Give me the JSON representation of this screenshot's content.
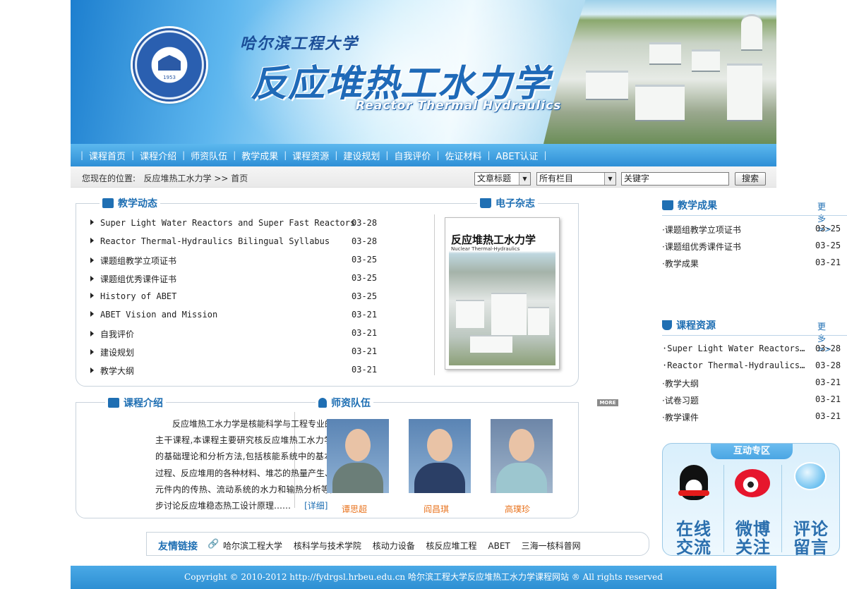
{
  "banner": {
    "university_calligraphy": "哈尔滨工程大学",
    "title": "反应堆热工水力学",
    "subtitle": "Reactor Thermal Hydraulics",
    "seal_year": "1953"
  },
  "nav": {
    "items": [
      "课程首页",
      "课程介绍",
      "师资队伍",
      "教学成果",
      "课程资源",
      "建设规划",
      "自我评价",
      "佐证材料",
      "ABET认证"
    ]
  },
  "location": {
    "label": "您现在的位置:",
    "path": "反应堆热工水力学 >> 首页"
  },
  "search": {
    "type_select": "文章标题",
    "column_select": "所有栏目",
    "keyword_placeholder": "关键字",
    "button": "搜索"
  },
  "news": {
    "title": "教学动态",
    "items": [
      {
        "text": "Super Light Water Reactors and Super Fast Reactors",
        "date": "03-28"
      },
      {
        "text": "Reactor Thermal-Hydraulics Bilingual Syllabus",
        "date": "03-28"
      },
      {
        "text": "课题组教学立项证书",
        "date": "03-25"
      },
      {
        "text": "课题组优秀课件证书",
        "date": "03-25"
      },
      {
        "text": "History of ABET",
        "date": "03-25"
      },
      {
        "text": "ABET Vision and Mission",
        "date": "03-21"
      },
      {
        "text": "自我评价",
        "date": "03-21"
      },
      {
        "text": "建设规划",
        "date": "03-21"
      },
      {
        "text": "教学大纲",
        "date": "03-21"
      }
    ]
  },
  "magazine": {
    "title": "电子杂志",
    "cover_title": "反应堆热工水力学",
    "cover_subtitle": "Nuclear Thermal-Hydraulics"
  },
  "achievements": {
    "title": "教学成果",
    "more": "更多>>",
    "items": [
      {
        "text": "·课题组教学立项证书",
        "date": "03-25"
      },
      {
        "text": "·课题组优秀课件证书",
        "date": "03-25"
      },
      {
        "text": "·教学成果",
        "date": "03-21"
      }
    ]
  },
  "resources": {
    "title": "课程资源",
    "more": "更多>>",
    "items": [
      {
        "text": "·Super Light Water Reactors…",
        "date": "03-28"
      },
      {
        "text": "·Reactor Thermal-Hydraulics…",
        "date": "03-28"
      },
      {
        "text": "·教学大纲",
        "date": "03-21"
      },
      {
        "text": "·试卷习题",
        "date": "03-21"
      },
      {
        "text": "·教学课件",
        "date": "03-21"
      }
    ]
  },
  "intro": {
    "title": "课程介绍",
    "text": "反应堆热工水力学是核能科学与工程专业的一门主干课程,本课程主要研究核反应堆热工水力学分析的基础理论和分析方法,包括核能系统中的基本热力过程、反应堆用的各种材料、堆芯的热量产生、燃料元件内的传热、流动系统的水力和输热分析等,进一步讨论反应堆稳态热工设计原理……",
    "detail": "[详细]"
  },
  "faculty": {
    "title": "师资队伍",
    "more": "MORE",
    "people": [
      "谭思超",
      "阎昌琪",
      "高璞珍"
    ]
  },
  "links": {
    "title": "友情链接",
    "items": [
      "哈尔滨工程大学",
      "核科学与技术学院",
      "核动力设备",
      "核反应堆工程",
      "ABET",
      "三海一核科普网"
    ]
  },
  "interaction": {
    "title": "互动专区",
    "boxes": [
      "在线交流",
      "微博关注",
      "评论留言"
    ]
  },
  "footer": {
    "text": "Copyright © 2010-2012 http://fydrgsl.hrbeu.edu.cn 哈尔滨工程大学反应堆热工水力学课程网站 ® All rights reserved"
  }
}
